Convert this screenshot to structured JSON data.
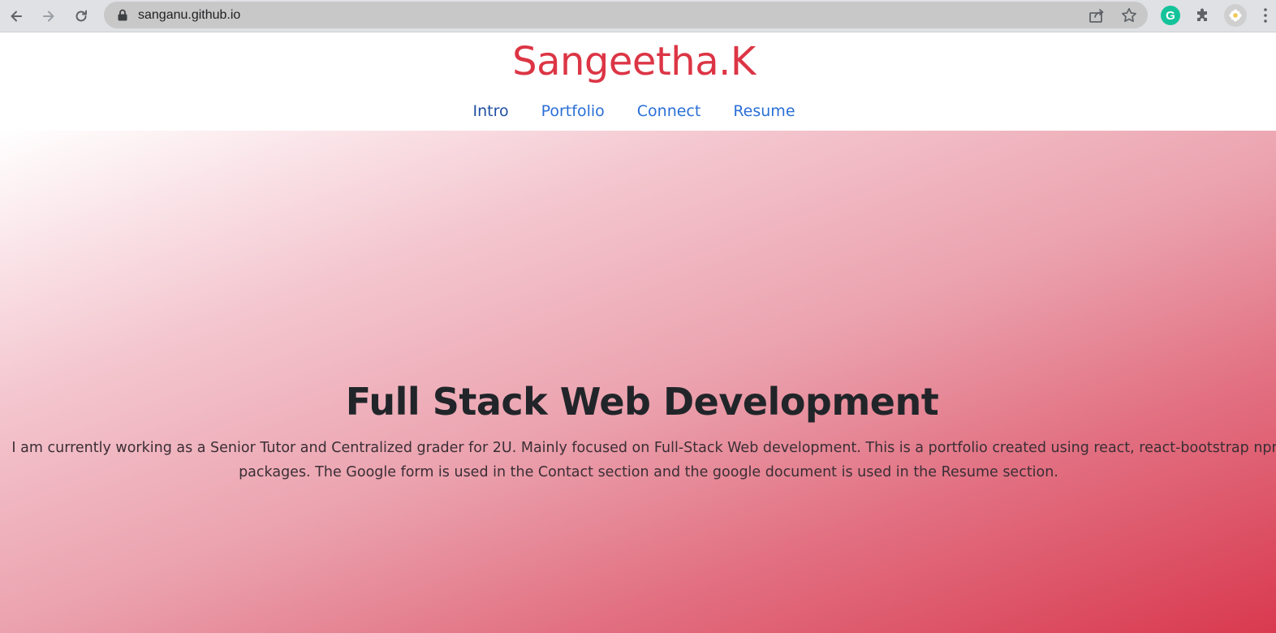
{
  "browser": {
    "url": "sanganu.github.io",
    "icons": {
      "back": "arrow-left-icon",
      "forward": "arrow-right-icon",
      "reload": "reload-icon",
      "lock": "lock-icon",
      "share": "share-icon",
      "bookmark": "star-icon",
      "grammarly": "grammarly-extension-icon",
      "extensions": "puzzle-icon",
      "profile": "profile-avatar-icon",
      "menu": "kebab-menu-icon"
    },
    "grammarly_letter": "G"
  },
  "header": {
    "brand": "Sangeetha.K",
    "brand_color": "#dc3545",
    "nav": [
      {
        "label": "Intro"
      },
      {
        "label": "Portfolio"
      },
      {
        "label": "Connect"
      },
      {
        "label": "Resume"
      }
    ],
    "link_color": "#2a6fd6"
  },
  "hero": {
    "title": "Full Stack Web Development",
    "description": "I am currently working as a Senior Tutor and Centralized grader for 2U. Mainly focused on Full-Stack Web development. This is a portfolio created using react, react-bootstrap npm packages. The Google form is used in the Contact section and the google document is used in the Resume section.",
    "gradient_start": "#ffffff",
    "gradient_end": "#d9394f"
  }
}
